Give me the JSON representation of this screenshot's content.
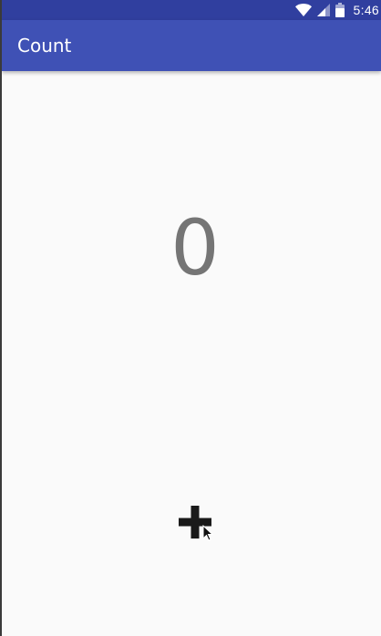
{
  "status_bar": {
    "time": "5:46",
    "icons": [
      "wifi-icon",
      "cellular-signal-icon",
      "battery-icon"
    ],
    "color": "#303f9f"
  },
  "app_bar": {
    "title": "Count",
    "color": "#3f51b5"
  },
  "main": {
    "count_value": "0",
    "count_color": "#757575",
    "increment_icon": "plus-icon"
  }
}
